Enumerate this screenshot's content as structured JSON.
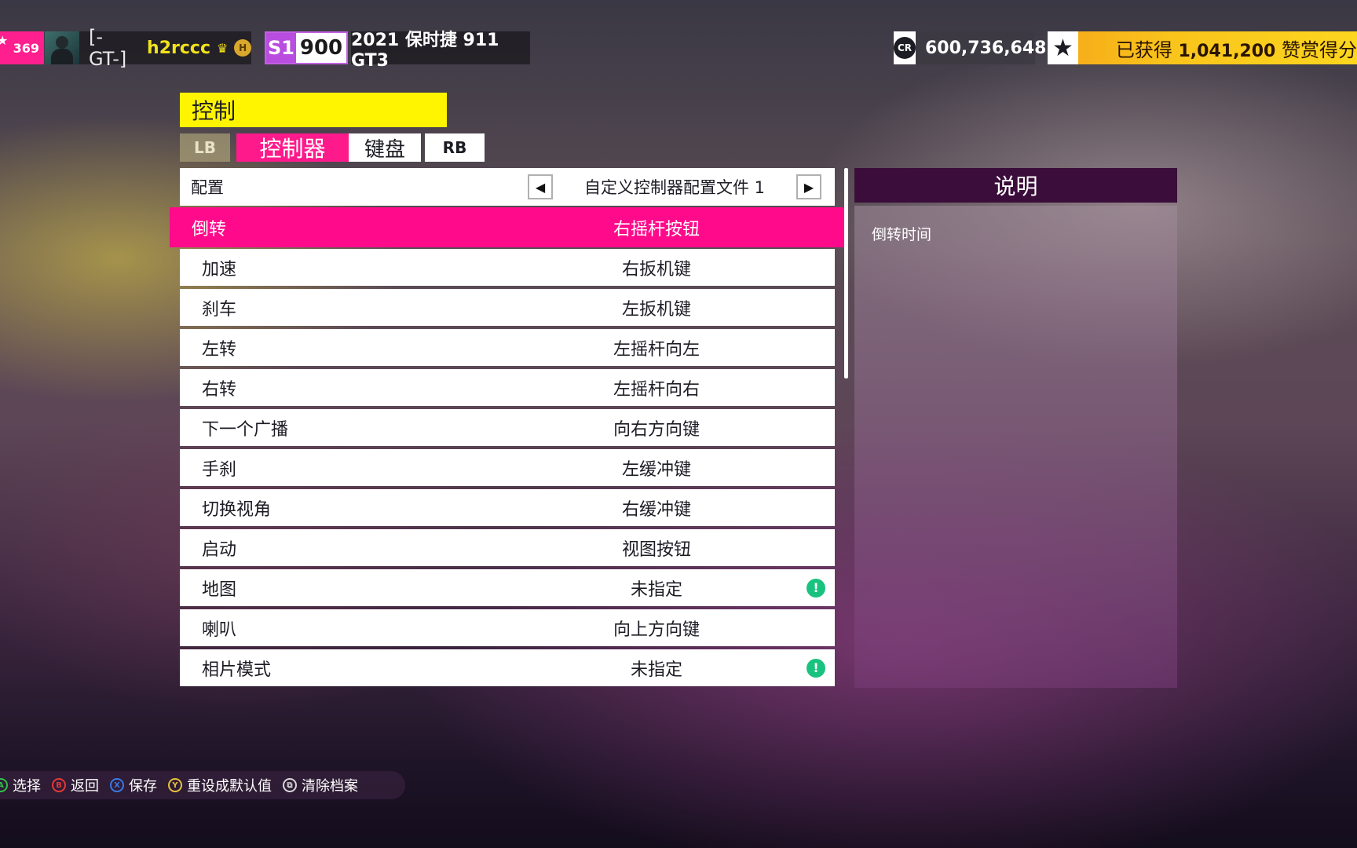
{
  "hud": {
    "level": "369",
    "player_tag": "[-GT-]",
    "player_name": "h2rccc",
    "pi_class": "S1",
    "pi_value": "900",
    "car_name": "2021 保时捷 911 GT3",
    "credits": "600,736,648",
    "credits_icon_text": "CR",
    "accolades_prefix": "已获得 ",
    "accolades_value": "1,041,200",
    "accolades_suffix": " 赞赏得分"
  },
  "page": {
    "title": "控制",
    "tab_lb": "LB",
    "tab_controller": "控制器",
    "tab_keyboard": "键盘",
    "tab_rb": "RB"
  },
  "config": {
    "label": "配置",
    "value": "自定义控制器配置文件 1"
  },
  "bindings": [
    {
      "action": "倒转",
      "binding": "右摇杆按钮",
      "selected": true,
      "warning": false
    },
    {
      "action": "加速",
      "binding": "右扳机键",
      "warning": false
    },
    {
      "action": "刹车",
      "binding": "左扳机键",
      "warning": false
    },
    {
      "action": "左转",
      "binding": "左摇杆向左",
      "warning": false
    },
    {
      "action": "右转",
      "binding": "左摇杆向右",
      "warning": false
    },
    {
      "action": "下一个广播",
      "binding": "向右方向键",
      "warning": false
    },
    {
      "action": "手刹",
      "binding": "左缓冲键",
      "warning": false
    },
    {
      "action": "切换视角",
      "binding": "右缓冲键",
      "warning": false
    },
    {
      "action": "启动",
      "binding": "视图按钮",
      "warning": false
    },
    {
      "action": "地图",
      "binding": "未指定",
      "warning": true
    },
    {
      "action": "喇叭",
      "binding": "向上方向键",
      "warning": false
    },
    {
      "action": "相片模式",
      "binding": "未指定",
      "warning": true
    }
  ],
  "description": {
    "header": "说明",
    "text": "倒转时间"
  },
  "footer": {
    "select": "选择",
    "back": "返回",
    "save": "保存",
    "reset": "重设成默认值",
    "clear": "清除档案"
  },
  "colors": {
    "accent_pink": "#ff0a8a",
    "title_yellow": "#fff500",
    "warning_green": "#19c27f",
    "desc_header": "#3b0d3a"
  }
}
